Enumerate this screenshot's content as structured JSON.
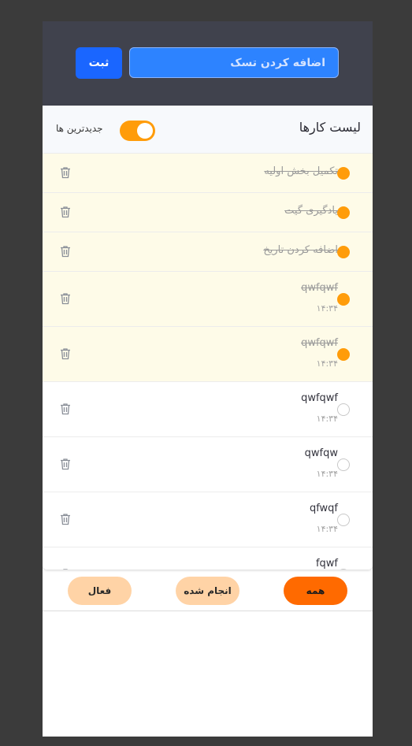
{
  "header": {
    "input_placeholder": "اضافه کردن تسک",
    "submit_label": "ثبت"
  },
  "list": {
    "title": "لیست کارها",
    "sort_toggle_label": "جدیدترین ها",
    "sort_toggle_on": true,
    "items": [
      {
        "title": "تکمیل بخش اولیه",
        "time": "",
        "done": true
      },
      {
        "title": "یادگیری گیت",
        "time": "",
        "done": true
      },
      {
        "title": "اضافه کردن تاریخ",
        "time": "",
        "done": true
      },
      {
        "title": "qwfqwf",
        "time": "۱۴:۳۴",
        "done": true
      },
      {
        "title": "qwfqwf",
        "time": "۱۴:۳۴",
        "done": true
      },
      {
        "title": "qwfqwf",
        "time": "۱۴:۳۴",
        "done": false
      },
      {
        "title": "qwfqw",
        "time": "۱۴:۳۴",
        "done": false
      },
      {
        "title": "qfwqf",
        "time": "۱۴:۳۴",
        "done": false
      },
      {
        "title": "fqwf",
        "time": "",
        "done": false
      }
    ]
  },
  "filters": {
    "all_label": "همه",
    "done_label": "انجام شده",
    "active_label": "فعال",
    "selected": "all"
  },
  "colors": {
    "header_bg": "#40424d",
    "input_bg": "#2d83ff",
    "submit_bg": "#1a66ff",
    "accent_orange": "#ff9c0a",
    "filter_active": "#ff6a00",
    "filter_inactive": "#ffd3a6",
    "done_row_bg": "#fefbe8"
  }
}
